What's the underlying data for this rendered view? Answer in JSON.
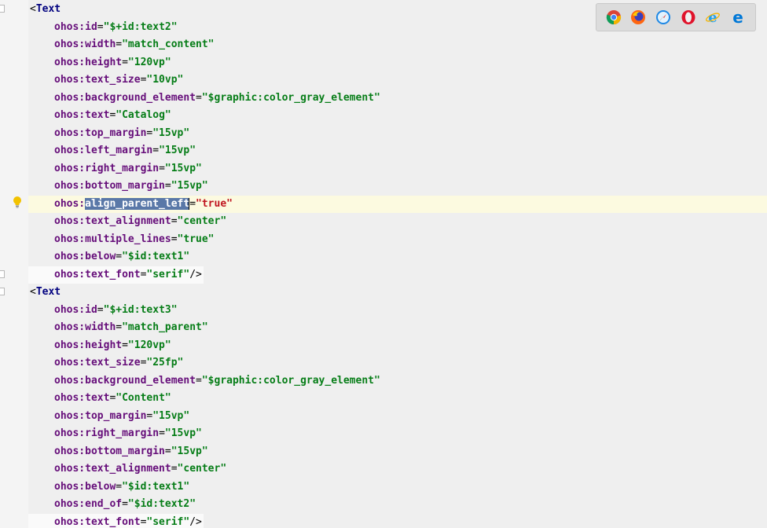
{
  "browser_icons": [
    {
      "name": "chrome-icon",
      "label": "Chrome"
    },
    {
      "name": "firefox-icon",
      "label": "Firefox"
    },
    {
      "name": "safari-icon",
      "label": "Safari"
    },
    {
      "name": "opera-icon",
      "label": "Opera"
    },
    {
      "name": "ie-icon",
      "label": "Internet Explorer"
    },
    {
      "name": "edge-icon",
      "label": "Edge"
    }
  ],
  "code": {
    "block1": {
      "tag_open": "<",
      "tag_name": "Text",
      "attrs": [
        {
          "name": "ohos:id",
          "value": "\"$+id:text2\""
        },
        {
          "name": "ohos:width",
          "value": "\"match_content\""
        },
        {
          "name": "ohos:height",
          "value": "\"120vp\""
        },
        {
          "name": "ohos:text_size",
          "value": "\"10vp\""
        },
        {
          "name": "ohos:background_element",
          "value": "\"$graphic:color_gray_element\""
        },
        {
          "name": "ohos:text",
          "value": "\"Catalog\""
        },
        {
          "name": "ohos:top_margin",
          "value": "\"15vp\""
        },
        {
          "name": "ohos:left_margin",
          "value": "\"15vp\""
        },
        {
          "name": "ohos:right_margin",
          "value": "\"15vp\""
        },
        {
          "name": "ohos:bottom_margin",
          "value": "\"15vp\""
        },
        {
          "name": "ohos:",
          "selected": "align_parent_left",
          "value": "\"true\""
        },
        {
          "name": "ohos:text_alignment",
          "value": "\"center\""
        },
        {
          "name": "ohos:multiple_lines",
          "value": "\"true\""
        },
        {
          "name": "ohos:below",
          "value": "\"$id:text1\""
        },
        {
          "name": "ohos:text_font",
          "value": "\"serif\"",
          "close": "/>"
        }
      ]
    },
    "block2": {
      "tag_open": "<",
      "tag_name": "Text",
      "attrs": [
        {
          "name": "ohos:id",
          "value": "\"$+id:text3\""
        },
        {
          "name": "ohos:width",
          "value": "\"match_parent\""
        },
        {
          "name": "ohos:height",
          "value": "\"120vp\""
        },
        {
          "name": "ohos:text_size",
          "value": "\"25fp\""
        },
        {
          "name": "ohos:background_element",
          "value": "\"$graphic:color_gray_element\""
        },
        {
          "name": "ohos:text",
          "value": "\"Content\""
        },
        {
          "name": "ohos:top_margin",
          "value": "\"15vp\""
        },
        {
          "name": "ohos:right_margin",
          "value": "\"15vp\""
        },
        {
          "name": "ohos:bottom_margin",
          "value": "\"15vp\""
        },
        {
          "name": "ohos:text_alignment",
          "value": "\"center\""
        },
        {
          "name": "ohos:below",
          "value": "\"$id:text1\""
        },
        {
          "name": "ohos:end_of",
          "value": "\"$id:text2\""
        },
        {
          "name": "ohos:text_font",
          "value": "\"serif\"",
          "close": "/>"
        }
      ]
    },
    "equals": "="
  },
  "colors": {
    "attr": "#660e7a",
    "value": "#067d17",
    "selected_value": "#c0151f",
    "tag": "#00007f",
    "selection": "#5a78a8",
    "current_line": "#fcfae0"
  }
}
